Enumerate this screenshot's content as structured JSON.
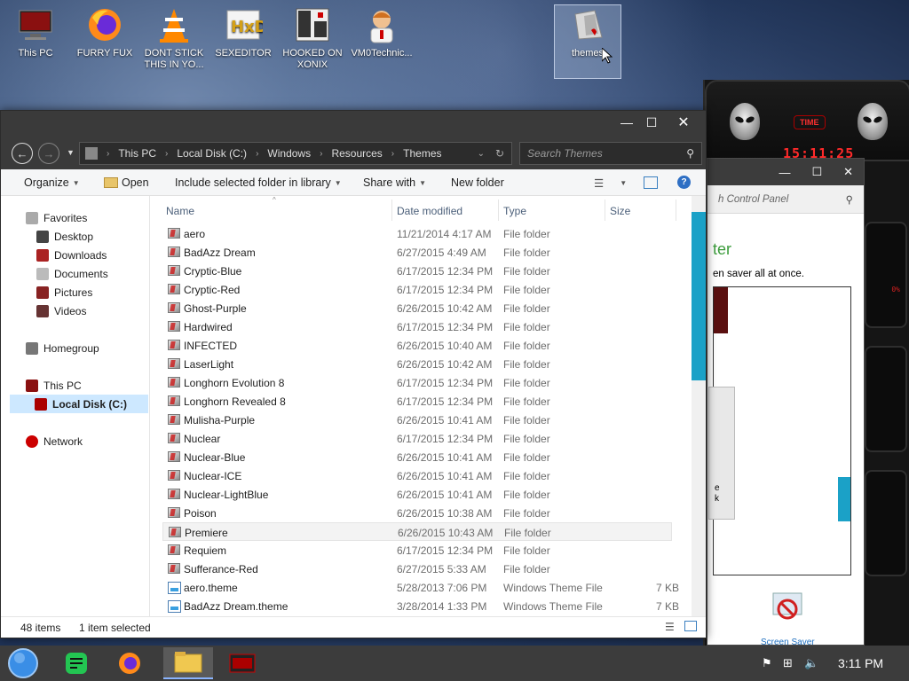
{
  "desktop": {
    "icons": [
      {
        "label": "This PC",
        "name": "this-pc"
      },
      {
        "label": "FURRY FUX",
        "name": "firefox"
      },
      {
        "label": "DONT STICK THIS IN YO...",
        "name": "vlc"
      },
      {
        "label": "SEXEDITOR",
        "name": "hxd"
      },
      {
        "label": "HOOKED ON XONIX",
        "name": "xonix"
      },
      {
        "label": "VM0Technic...",
        "name": "vm-technician"
      },
      {
        "label": "themes",
        "name": "themes"
      }
    ]
  },
  "widget": {
    "time_label": "TIME",
    "clock": "15:11:25",
    "percent_label": "0%"
  },
  "control_panel": {
    "search_placeholder": "h Control Panel",
    "heading": "ter",
    "text": "en saver all at once.",
    "snippet_e": "e",
    "snippet_k": "k",
    "footer_link": "Screen Saver"
  },
  "explorer": {
    "address": [
      "This PC",
      "Local Disk (C:)",
      "Windows",
      "Resources",
      "Themes"
    ],
    "search_placeholder": "Search Themes",
    "toolbar": {
      "organize": "Organize",
      "open": "Open",
      "include": "Include selected folder in library",
      "share": "Share with",
      "new_folder": "New folder"
    },
    "nav": {
      "favorites": "Favorites",
      "desktop": "Desktop",
      "downloads": "Downloads",
      "documents": "Documents",
      "pictures": "Pictures",
      "videos": "Videos",
      "homegroup": "Homegroup",
      "this_pc": "This PC",
      "local_disk": "Local Disk (C:)",
      "network": "Network"
    },
    "columns": {
      "name": "Name",
      "date": "Date modified",
      "type": "Type",
      "size": "Size"
    },
    "files": [
      {
        "name": "aero",
        "date": "11/21/2014 4:17 AM",
        "type": "File folder",
        "size": ""
      },
      {
        "name": "BadAzz Dream",
        "date": "6/27/2015 4:49 AM",
        "type": "File folder",
        "size": ""
      },
      {
        "name": "Cryptic-Blue",
        "date": "6/17/2015 12:34 PM",
        "type": "File folder",
        "size": ""
      },
      {
        "name": "Cryptic-Red",
        "date": "6/17/2015 12:34 PM",
        "type": "File folder",
        "size": ""
      },
      {
        "name": "Ghost-Purple",
        "date": "6/26/2015 10:42 AM",
        "type": "File folder",
        "size": ""
      },
      {
        "name": "Hardwired",
        "date": "6/17/2015 12:34 PM",
        "type": "File folder",
        "size": ""
      },
      {
        "name": "INFECTED",
        "date": "6/26/2015 10:40 AM",
        "type": "File folder",
        "size": ""
      },
      {
        "name": "LaserLight",
        "date": "6/26/2015 10:42 AM",
        "type": "File folder",
        "size": ""
      },
      {
        "name": "Longhorn Evolution 8",
        "date": "6/17/2015 12:34 PM",
        "type": "File folder",
        "size": ""
      },
      {
        "name": "Longhorn Revealed 8",
        "date": "6/17/2015 12:34 PM",
        "type": "File folder",
        "size": ""
      },
      {
        "name": "Mulisha-Purple",
        "date": "6/26/2015 10:41 AM",
        "type": "File folder",
        "size": ""
      },
      {
        "name": "Nuclear",
        "date": "6/17/2015 12:34 PM",
        "type": "File folder",
        "size": ""
      },
      {
        "name": "Nuclear-Blue",
        "date": "6/26/2015 10:41 AM",
        "type": "File folder",
        "size": ""
      },
      {
        "name": "Nuclear-ICE",
        "date": "6/26/2015 10:41 AM",
        "type": "File folder",
        "size": ""
      },
      {
        "name": "Nuclear-LightBlue",
        "date": "6/26/2015 10:41 AM",
        "type": "File folder",
        "size": ""
      },
      {
        "name": "Poison",
        "date": "6/26/2015 10:38 AM",
        "type": "File folder",
        "size": ""
      },
      {
        "name": "Premiere",
        "date": "6/26/2015 10:43 AM",
        "type": "File folder",
        "size": ""
      },
      {
        "name": "Requiem",
        "date": "6/17/2015 12:34 PM",
        "type": "File folder",
        "size": ""
      },
      {
        "name": "Sufferance-Red",
        "date": "6/27/2015 5:33 AM",
        "type": "File folder",
        "size": ""
      },
      {
        "name": "aero.theme",
        "date": "5/28/2013 7:06 PM",
        "type": "Windows Theme File",
        "size": "7 KB"
      },
      {
        "name": "BadAzz Dream.theme",
        "date": "3/28/2014 1:33 PM",
        "type": "Windows Theme File",
        "size": "7 KB"
      }
    ],
    "status": {
      "count": "48 items",
      "selected": "1 item selected"
    }
  },
  "taskbar": {
    "clock": "3:11 PM"
  },
  "colors": {
    "accent": "#1ba1c7",
    "titlebar": "#3a3a3a",
    "widget_red": "#ff2a2a"
  }
}
